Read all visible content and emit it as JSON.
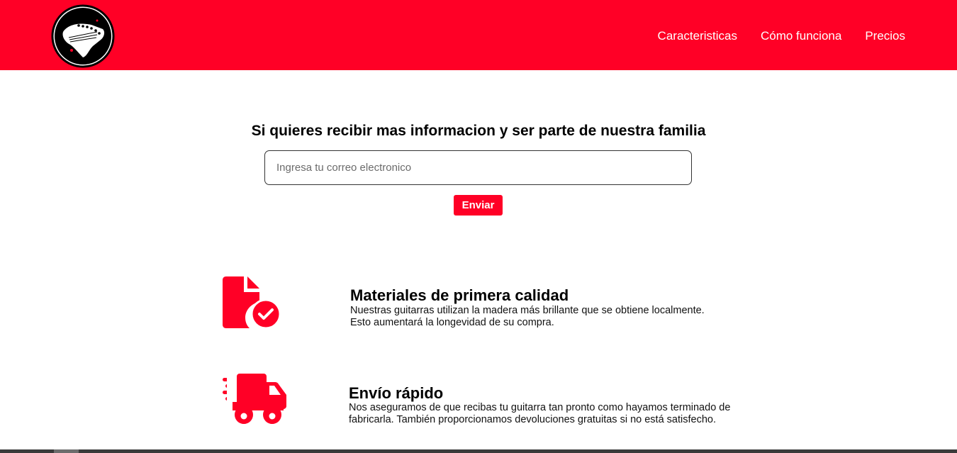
{
  "header": {
    "logo_icon": "guitar-headstock-logo",
    "brand_color": "#ff0026",
    "nav": [
      {
        "label": "Caracteristicas"
      },
      {
        "label": "Cómo funciona"
      },
      {
        "label": "Precios"
      }
    ]
  },
  "signup": {
    "title": "Si quieres recibir mas informacion y ser parte de nuestra familia",
    "email_placeholder": "Ingresa tu correo electronico",
    "email_value": "",
    "submit_label": "Enviar"
  },
  "features": [
    {
      "icon": "file-check-icon",
      "title": "Materiales de primera calidad",
      "text": "Nuestras guitarras utilizan la madera más brillante que se obtiene localmente. Esto aumentará la longevidad de su compra."
    },
    {
      "icon": "fast-truck-icon",
      "title": "Envío rápido",
      "text": "Nos aseguramos de que recibas tu guitarra tan pronto como hayamos terminado de fabricarla. También proporcionamos devoluciones gratuitas si no está satisfecho."
    }
  ]
}
